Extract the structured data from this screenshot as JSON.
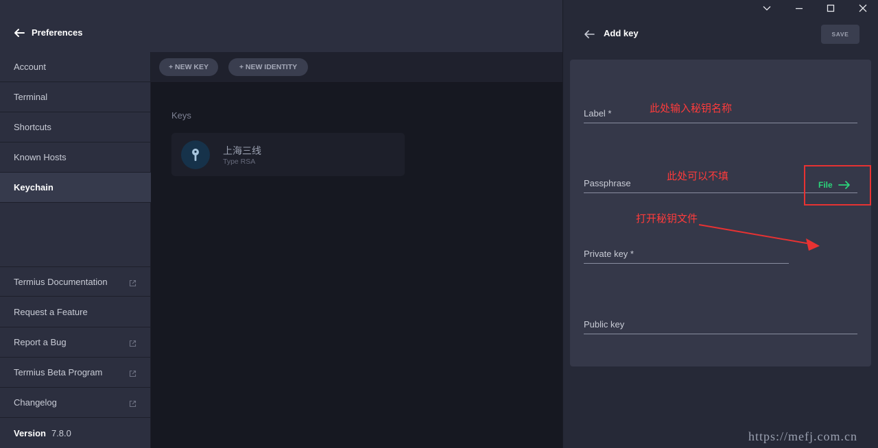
{
  "header": {
    "title": "Preferences"
  },
  "sidebar": {
    "items": [
      {
        "label": "Account"
      },
      {
        "label": "Terminal"
      },
      {
        "label": "Shortcuts"
      },
      {
        "label": "Known Hosts"
      },
      {
        "label": "Keychain",
        "active": true
      }
    ],
    "links": [
      {
        "label": "Termius Documentation",
        "external": true
      },
      {
        "label": "Request a Feature",
        "external": false
      },
      {
        "label": "Report a Bug",
        "external": true
      },
      {
        "label": "Termius Beta Program",
        "external": true
      },
      {
        "label": "Changelog",
        "external": true
      }
    ],
    "version_label": "Version",
    "version_value": "7.8.0"
  },
  "toolbar": {
    "new_key_label": "+ NEW KEY",
    "new_identity_label": "+ NEW IDENTITY"
  },
  "keys": {
    "heading": "Keys",
    "items": [
      {
        "name": "上海三线",
        "type": "Type RSA"
      }
    ]
  },
  "add_key": {
    "title": "Add key",
    "save_label": "SAVE",
    "fields": {
      "label": "Label *",
      "passphrase": "Passphrase",
      "private_key": "Private key *",
      "public_key": "Public key"
    },
    "file_label": "File"
  },
  "annotations": {
    "label_hint": "此处输入秘钥名称",
    "passphrase_hint": "此处可以不填",
    "file_hint": "打开秘钥文件"
  },
  "watermark": "https://mefj.com.cn",
  "colors": {
    "accent_green": "#2bd67b",
    "annotation_red": "#ff3b3b",
    "panel_bg": "#262937",
    "card_bg": "#353849",
    "key_avatar_bg": "#16324a"
  }
}
